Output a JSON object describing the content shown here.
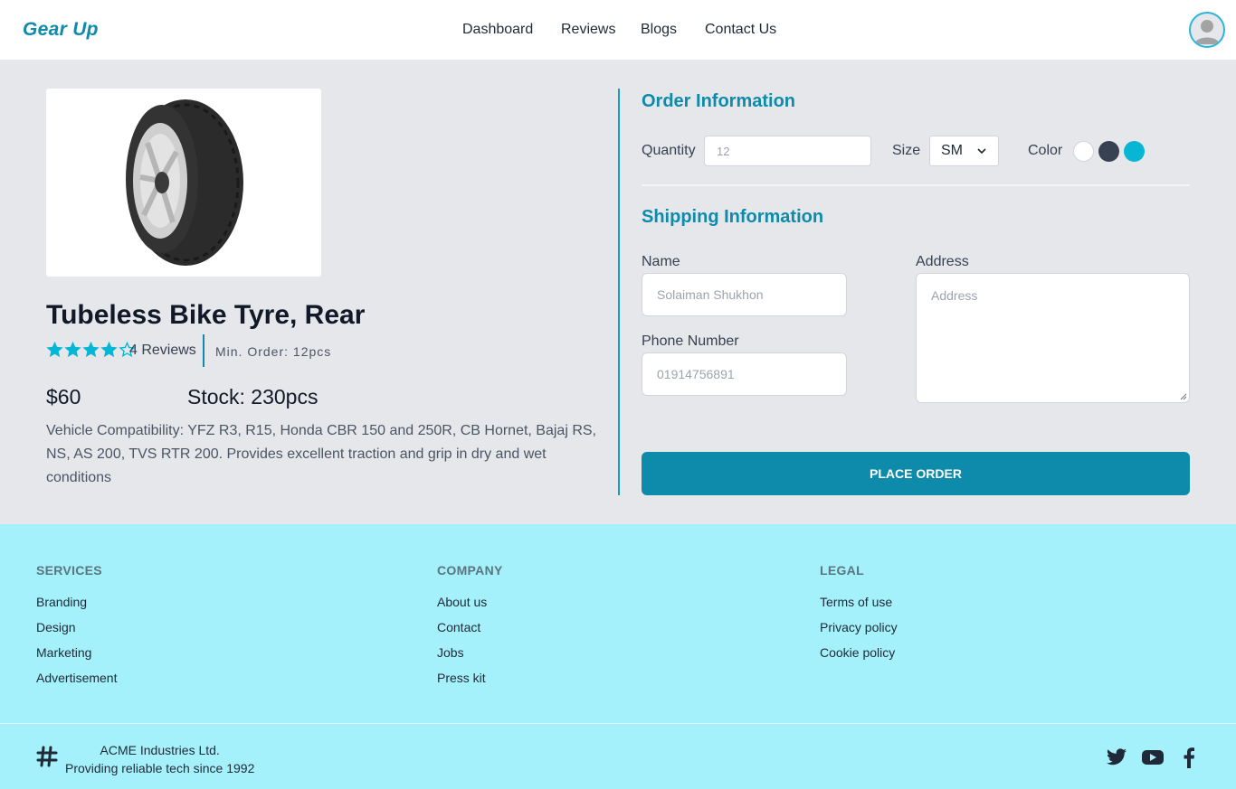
{
  "header": {
    "brand": "Gear Up",
    "nav": [
      "Dashboard",
      "Reviews",
      "Blogs",
      "Contact Us"
    ],
    "avatar_icon": "user-avatar-icon"
  },
  "product": {
    "title": "Tubeless Bike Tyre, Rear",
    "rating": 4,
    "rating_max": 5,
    "reviews": "4 Reviews",
    "min_order": "Min. Order: 12pcs",
    "price": "$60",
    "stock": "Stock: 230pcs",
    "description": "Vehicle Compatibility: YFZ R3, R15, Honda CBR 150 and 250R, CB Hornet, Bajaj RS, NS, AS 200, TVS RTR 200. Provides excellent traction and grip in dry and wet conditions"
  },
  "order": {
    "title": "Order Information",
    "quantity_label": "Quantity",
    "quantity_placeholder": "12",
    "size_label": "Size",
    "size_value": "SM",
    "color_label": "Color",
    "colors": [
      "#ffffff",
      "#374151",
      "#06b6d4"
    ]
  },
  "shipping": {
    "title": "Shipping Information",
    "name_label": "Name",
    "name_placeholder": "Solaiman Shukhon",
    "phone_label": "Phone Number",
    "phone_placeholder": "01914756891",
    "address_label": "Address",
    "address_placeholder": "Address",
    "button": "PLACE ORDER"
  },
  "footer": {
    "services": {
      "title": "SERVICES",
      "links": [
        "Branding",
        "Design",
        "Marketing",
        "Advertisement"
      ]
    },
    "company": {
      "title": "COMPANY",
      "links": [
        "About us",
        "Contact",
        "Jobs",
        "Press kit"
      ]
    },
    "legal": {
      "title": "LEGAL",
      "links": [
        "Terms of use",
        "Privacy policy",
        "Cookie policy"
      ]
    },
    "company_name": "ACME Industries Ltd.",
    "tagline": "Providing reliable tech since 1992",
    "social": [
      "twitter-icon",
      "youtube-icon",
      "facebook-icon"
    ]
  },
  "colors": {
    "accent": "#0e8aab",
    "star": "#06b6d4",
    "footer_bg": "#a5f1fb"
  }
}
